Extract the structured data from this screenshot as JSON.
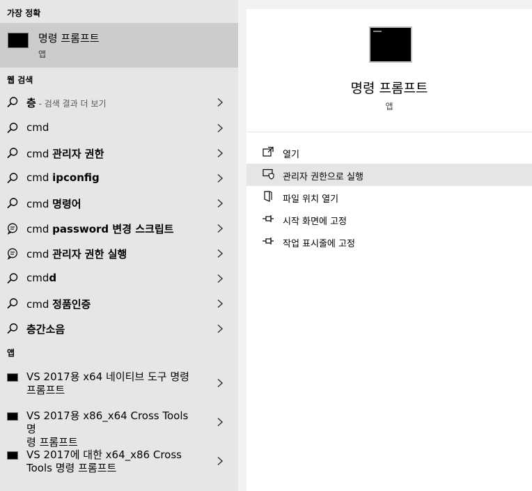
{
  "left": {
    "best_match_header": "가장 정확",
    "best_match": {
      "title": "명령 프롬프트",
      "subtitle": "앱"
    },
    "web_header": "웹 검색",
    "web_items": [
      {
        "bold": "층",
        "rest": "",
        "hint": " - 검색 결과 더 보기",
        "icon": "search-icon"
      },
      {
        "bold": "",
        "rest": "cmd",
        "hint": "",
        "icon": "search-icon"
      },
      {
        "pre": "cmd ",
        "bold": "관리자 권한",
        "icon": "search-icon"
      },
      {
        "pre": "cmd ",
        "bold": "ipconfig",
        "icon": "search-icon"
      },
      {
        "pre": "cmd ",
        "bold": "명령어",
        "icon": "search-icon"
      },
      {
        "pre": "cmd ",
        "bold": "password 변경 스크립트",
        "icon": "chat-icon"
      },
      {
        "pre": "cmd ",
        "bold": "관리자 권한 실행",
        "icon": "chat-icon"
      },
      {
        "pre": "cmd",
        "bold": "d",
        "icon": "search-icon"
      },
      {
        "pre": "cmd ",
        "bold": "정품인증",
        "icon": "search-icon"
      },
      {
        "pre": "",
        "bold": "층간소음",
        "icon": "search-icon"
      }
    ],
    "apps_header": "앱",
    "apps": [
      {
        "line1": "VS 2017용 x64 네이티브 도구 명령",
        "line2": "프롬프트"
      },
      {
        "line1": "VS 2017용 x86_x64 Cross Tools 명",
        "line2": "령 프롬프트"
      },
      {
        "line1": "VS 2017에 대한 x64_x86 Cross",
        "line2": "Tools 명령 프롬프트"
      }
    ]
  },
  "right": {
    "title": "명령 프롬프트",
    "subtitle": "앱",
    "actions": [
      {
        "label": "열기",
        "icon": "open-icon"
      },
      {
        "label": "관리자 권한으로 실행",
        "icon": "shield-icon"
      },
      {
        "label": "파일 위치 열기",
        "icon": "file-location-icon"
      },
      {
        "label": "시작 화면에 고정",
        "icon": "pin-icon"
      },
      {
        "label": "작업 표시줄에 고정",
        "icon": "pin-icon"
      }
    ]
  }
}
